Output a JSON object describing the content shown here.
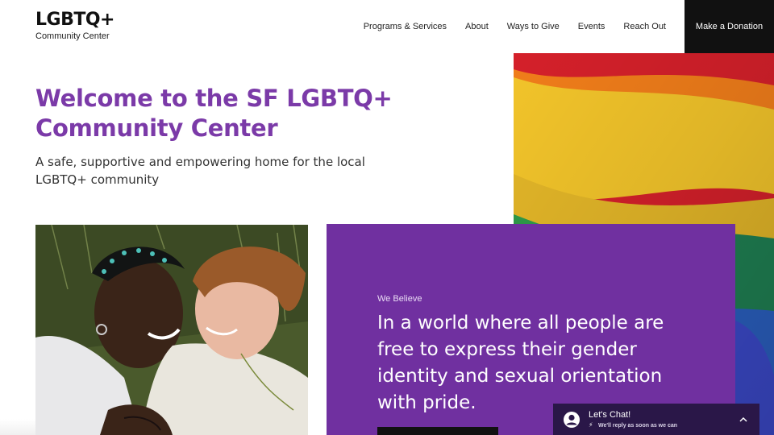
{
  "logo": {
    "title": "LGBTQ+",
    "subtitle": "Community Center"
  },
  "nav": {
    "items": [
      {
        "label": "Programs & Services"
      },
      {
        "label": "About"
      },
      {
        "label": "Ways to Give"
      },
      {
        "label": "Events"
      },
      {
        "label": "Reach Out"
      }
    ],
    "donate_label": "Make a Donation"
  },
  "hero": {
    "title": "Welcome to the SF LGBTQ+ Community Center",
    "subtitle": "A safe, supportive and empowering home for the local LGBTQ+ community"
  },
  "belief": {
    "eyebrow": "We Believe",
    "text": "In a world where all people are free to express their gender identity and sexual orientation with pride."
  },
  "chat": {
    "title": "Let's Chat!",
    "subtitle": "We'll reply as soon as we can",
    "avatar_icon": "user-avatar-icon",
    "bolt_icon": "lightning-bolt-icon",
    "chevron_icon": "chevron-up-icon"
  },
  "images": {
    "flag": "rainbow-pride-flag-photo",
    "photo": "couple-embracing-photo"
  },
  "colors": {
    "brand_purple": "#7b3aa8",
    "card_purple": "#7030a0",
    "chat_bg": "#2a1748",
    "donate_bg": "#111111"
  }
}
